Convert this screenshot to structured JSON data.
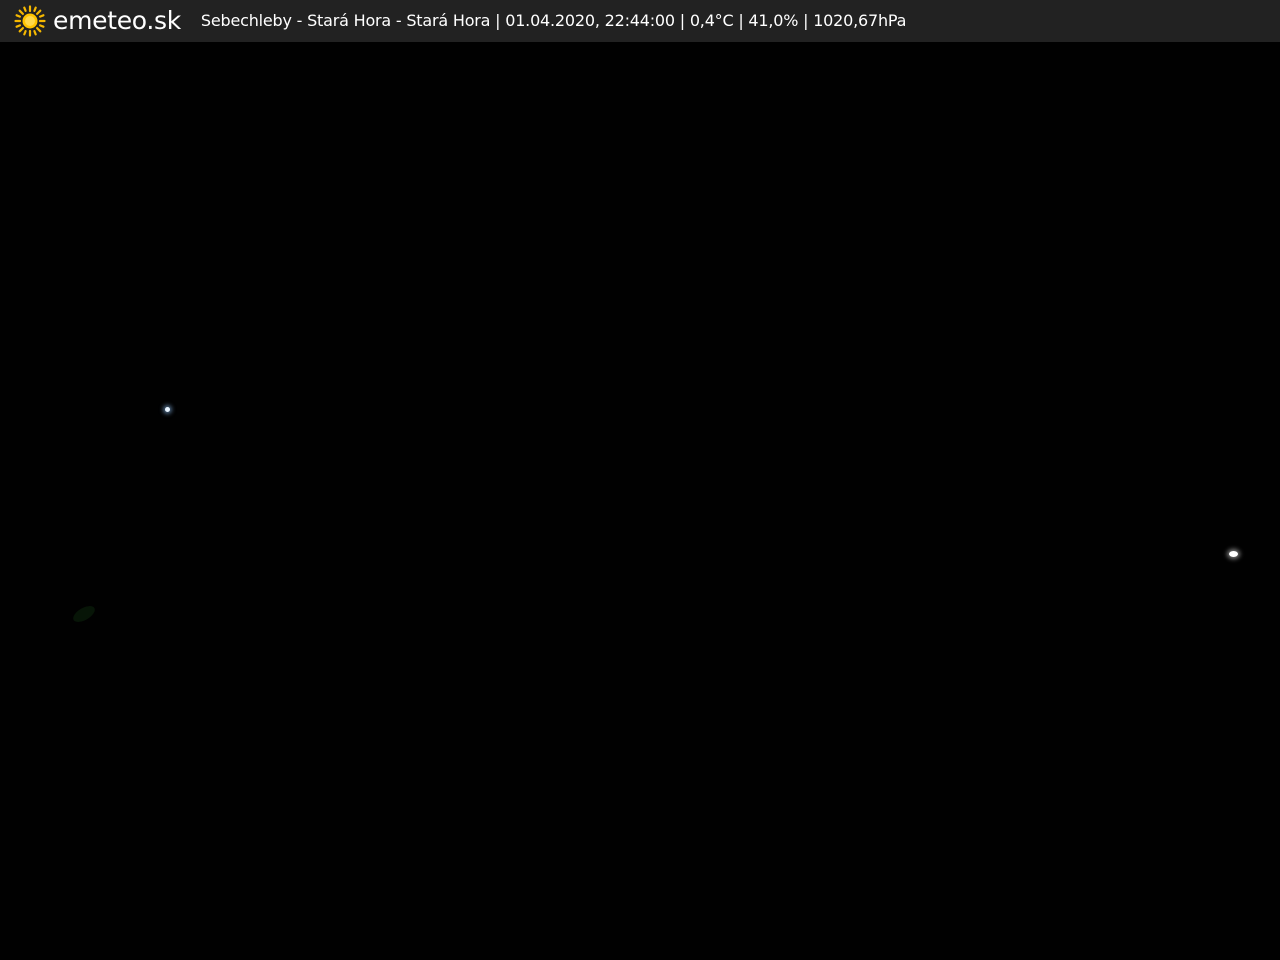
{
  "header": {
    "brand": "emeteo.sk",
    "logo_icon": "sun-icon",
    "accent_color": "#f5b800",
    "caption": "Sebechleby - Stará Hora - Stará Hora | 01.04.2020, 22:44:00 | 0,4°C | 41,0% | 1020,67hPa"
  },
  "colors": {
    "bar_background": "#222222",
    "scene_background": "#000000"
  }
}
